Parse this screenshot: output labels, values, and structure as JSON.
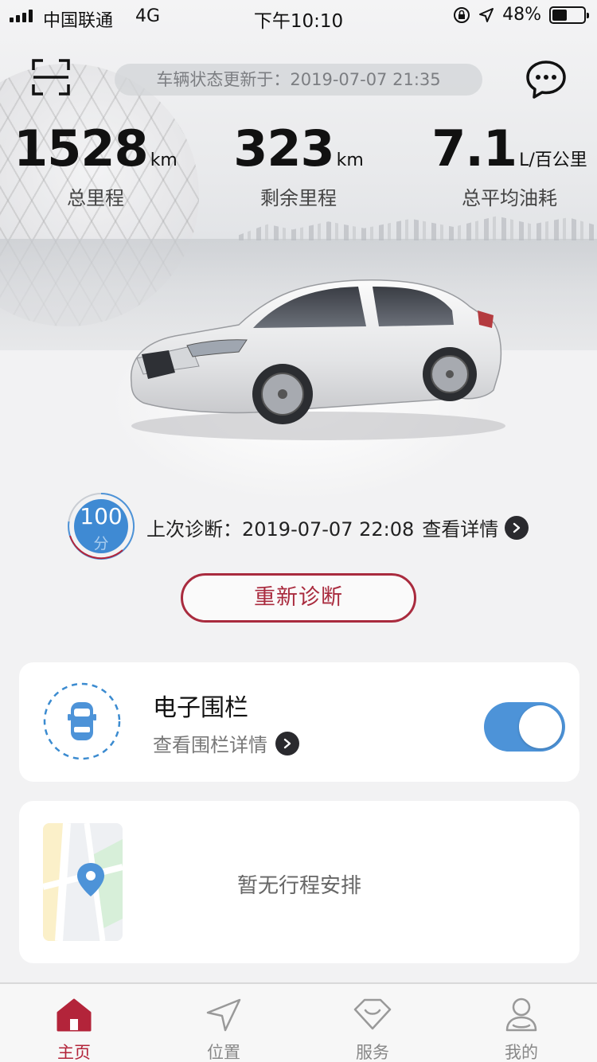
{
  "status_bar": {
    "carrier": "中国联通",
    "network": "4G",
    "time": "下午10:10",
    "battery": "48%",
    "battery_level": 0.48
  },
  "header": {
    "update_text": "车辆状态更新于：2019-07-07 21:35"
  },
  "stats": [
    {
      "value": "1528",
      "unit": "km",
      "label": "总里程"
    },
    {
      "value": "323",
      "unit": "km",
      "label": "剩余里程"
    },
    {
      "value": "7.1",
      "unit": "L/百公里",
      "label": "总平均油耗"
    }
  ],
  "diagnosis": {
    "score": "100",
    "score_unit": "分",
    "last_text": "上次诊断：2019-07-07 22:08",
    "detail_link": "查看详情",
    "rediagnose_button": "重新诊断"
  },
  "fence": {
    "title": "电子围栏",
    "subtitle": "查看围栏详情",
    "enabled": true
  },
  "trip": {
    "empty_text": "暂无行程安排"
  },
  "tabs": [
    {
      "label": "主页",
      "active": true
    },
    {
      "label": "位置",
      "active": false
    },
    {
      "label": "服务",
      "active": false
    },
    {
      "label": "我的",
      "active": false
    }
  ],
  "colors": {
    "accent": "#b3243a",
    "toggle": "#4d93d8",
    "score_blue": "#3f8ad3"
  }
}
